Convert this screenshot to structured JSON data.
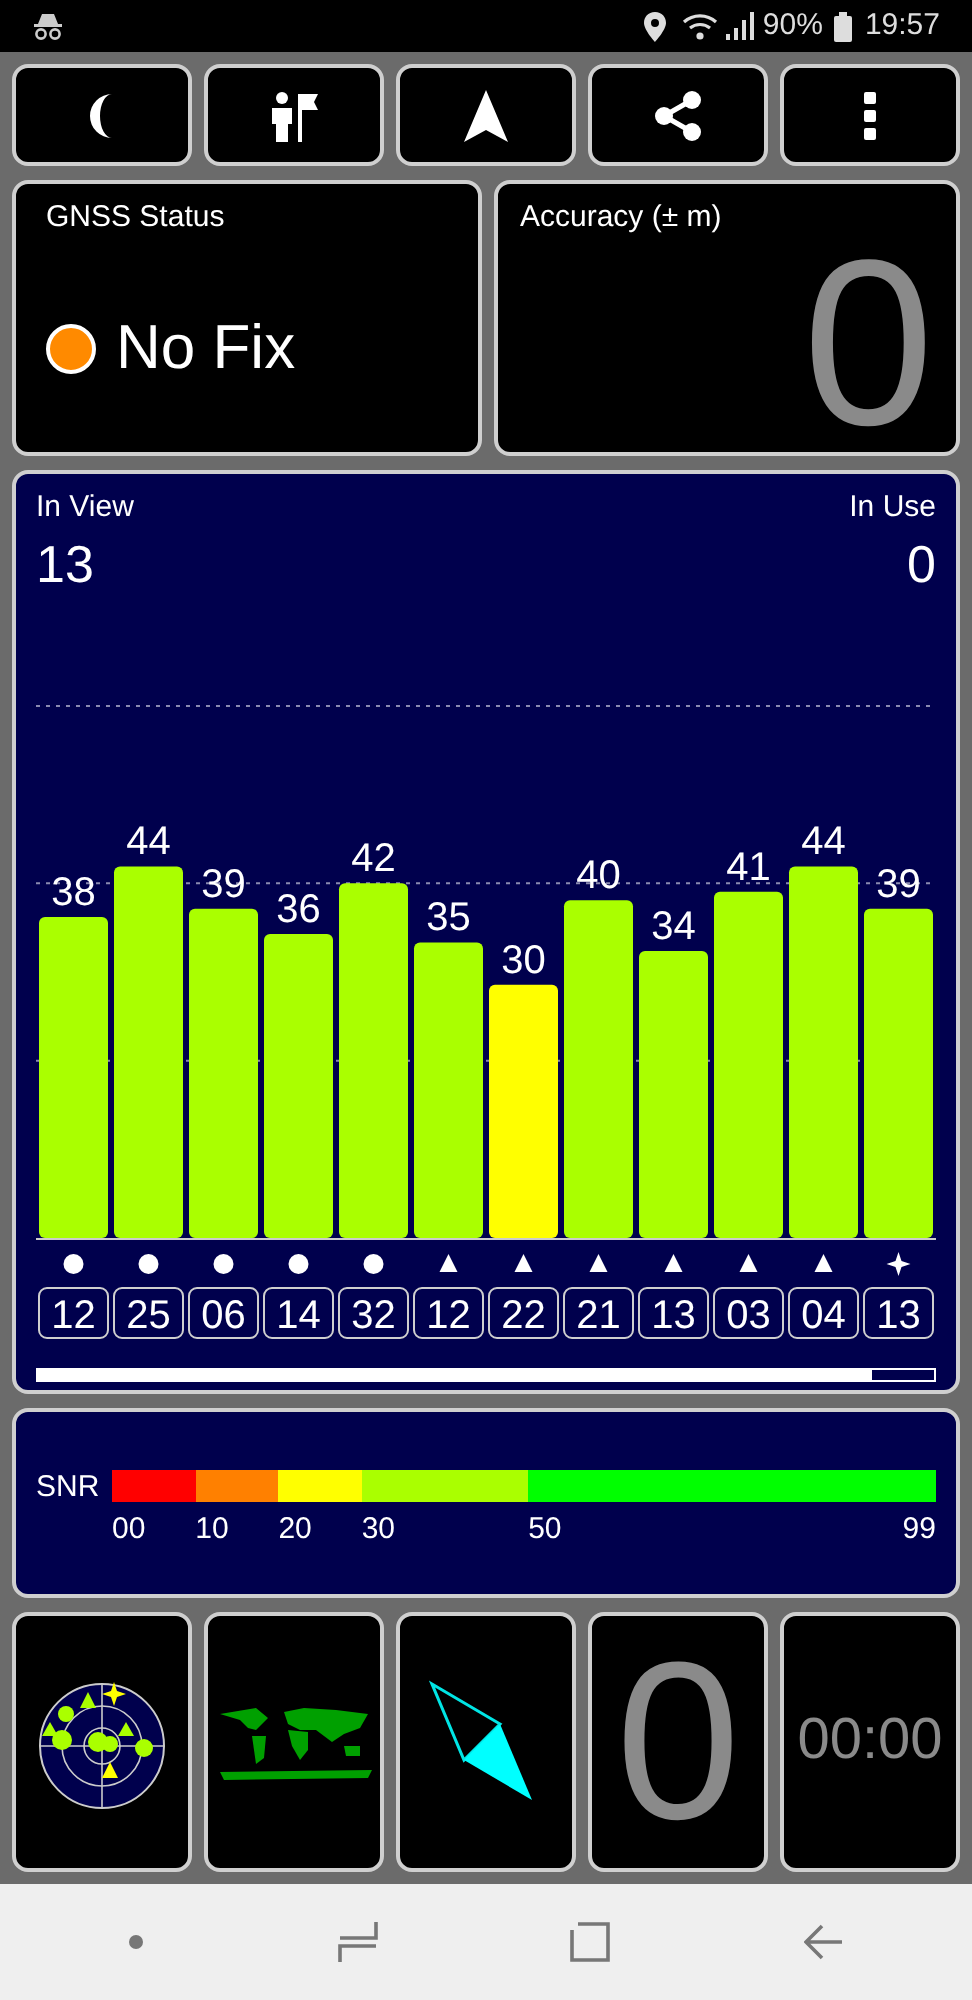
{
  "status_bar": {
    "battery": "90%",
    "time": "19:57"
  },
  "gnss_status": {
    "title": "GNSS Status",
    "value": "No Fix",
    "color": "#ff8a00"
  },
  "accuracy": {
    "title": "Accuracy (± m)",
    "value": "0"
  },
  "satellites": {
    "in_view_label": "In View",
    "in_view": "13",
    "in_use_label": "In Use",
    "in_use": "0",
    "chart_data": {
      "type": "bar",
      "categories": [
        "12",
        "25",
        "06",
        "14",
        "32",
        "12",
        "22",
        "21",
        "13",
        "03",
        "04",
        "13"
      ],
      "values": [
        38,
        44,
        39,
        36,
        42,
        35,
        30,
        40,
        34,
        41,
        44,
        39
      ],
      "data_labels": true
    },
    "items": [
      {
        "kind": "circle",
        "color": "#aaff00"
      },
      {
        "kind": "circle",
        "color": "#aaff00"
      },
      {
        "kind": "circle",
        "color": "#aaff00"
      },
      {
        "kind": "circle",
        "color": "#aaff00"
      },
      {
        "kind": "circle",
        "color": "#aaff00"
      },
      {
        "kind": "triangle",
        "color": "#aaff00"
      },
      {
        "kind": "triangle",
        "color": "#ffff00"
      },
      {
        "kind": "triangle",
        "color": "#aaff00"
      },
      {
        "kind": "triangle",
        "color": "#aaff00"
      },
      {
        "kind": "triangle",
        "color": "#aaff00"
      },
      {
        "kind": "triangle",
        "color": "#aaff00"
      },
      {
        "kind": "star",
        "color": "#aaff00"
      }
    ]
  },
  "snr_legend": {
    "label": "SNR",
    "segments": [
      {
        "color": "#ff0000"
      },
      {
        "color": "#ff8000"
      },
      {
        "color": "#ffff00"
      },
      {
        "color": "#aaff00"
      },
      {
        "color": "#00ff00"
      }
    ],
    "scale": [
      "00",
      "10",
      "20",
      "30",
      "50",
      "99"
    ]
  },
  "tiles": {
    "altitude": "0",
    "timer": "00:00"
  }
}
